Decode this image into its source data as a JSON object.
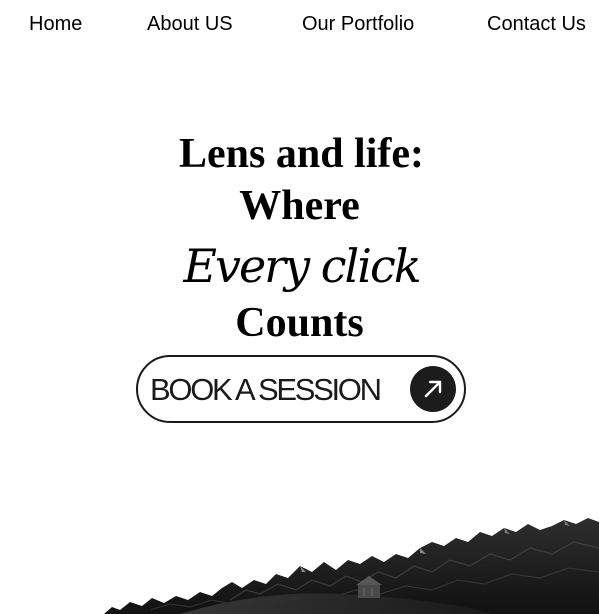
{
  "nav": {
    "items": [
      {
        "label": "Home"
      },
      {
        "label": "About US"
      },
      {
        "label": "Our Portfolio"
      },
      {
        "label": "Contact Us"
      }
    ]
  },
  "hero": {
    "line1": "Lens and life:",
    "line2": "Where",
    "line3": "Every click",
    "line4": "Counts"
  },
  "cta": {
    "label": "BOOK A SESSION",
    "icon": "arrow-up-right-icon",
    "border_color": "#1a1a1a",
    "icon_bg": "#1c1c1c"
  },
  "landscape": {
    "icon": "mountain-image"
  }
}
